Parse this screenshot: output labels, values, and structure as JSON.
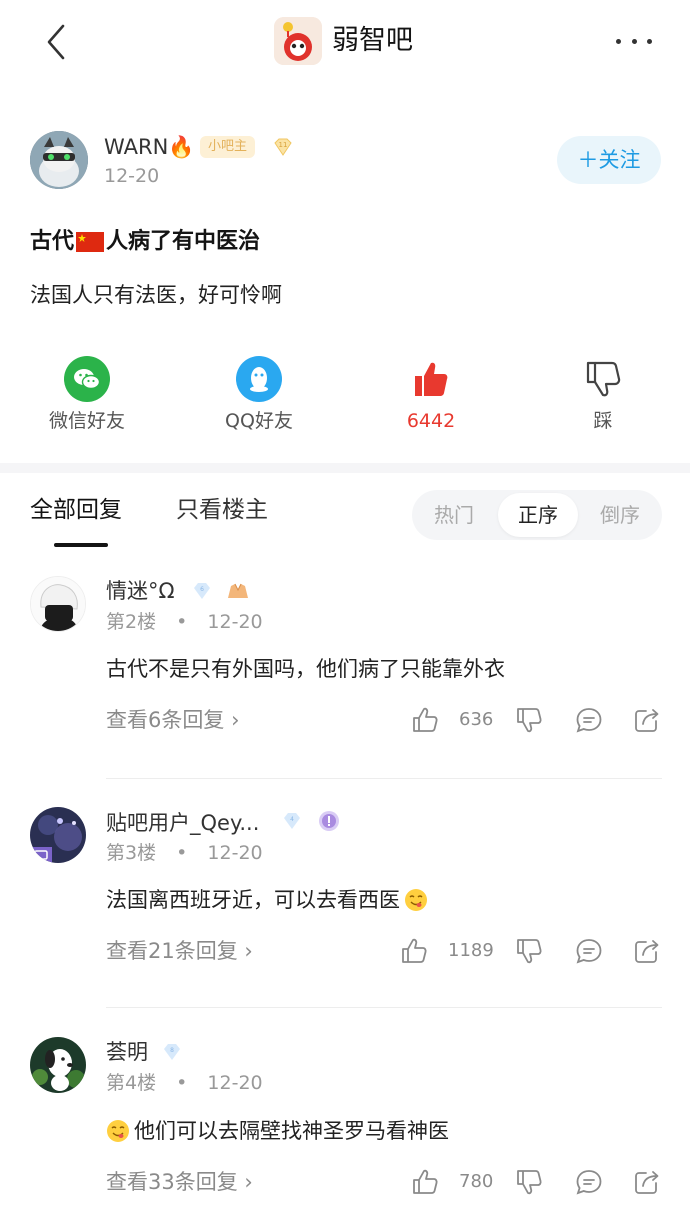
{
  "header": {
    "forum_name": "弱智吧"
  },
  "post": {
    "author": "WARN🔥",
    "author_badge": "小吧主",
    "date": "12-20",
    "follow_label": "＋关注",
    "title_before_flag": "古代",
    "title_after_flag": "人病了有中医治",
    "body": "法国人只有法医，好可怜啊"
  },
  "share_bar": {
    "wechat_label": "微信好友",
    "qq_label": "QQ好友",
    "like_count": "6442",
    "dislike_label": "踩"
  },
  "tabs": {
    "all_replies": "全部回复",
    "op_only": "只看楼主",
    "sort_hot": "热门",
    "sort_asc": "正序",
    "sort_desc": "倒序"
  },
  "comments": [
    {
      "user": "情迷°Ω",
      "floor": "第2楼",
      "date": "12-20",
      "text": "古代不是只有外国吗，他们病了只能靠外衣",
      "replies": "查看6条回复",
      "likes": "636"
    },
    {
      "user": "贴吧用户_Qey...",
      "floor": "第3楼",
      "date": "12-20",
      "text": "法国离西班牙近，可以去看西医",
      "replies": "查看21条回复",
      "likes": "1189"
    },
    {
      "user": "荟明",
      "floor": "第4楼",
      "date": "12-20",
      "text": "他们可以去隔壁找神圣罗马看神医",
      "replies": "查看33条回复",
      "likes": "780"
    }
  ],
  "colors": {
    "accent": "#1e9be3",
    "like_red": "#e8392f",
    "wechat_green": "#2bb34a",
    "qq_blue": "#2aa8f0"
  }
}
